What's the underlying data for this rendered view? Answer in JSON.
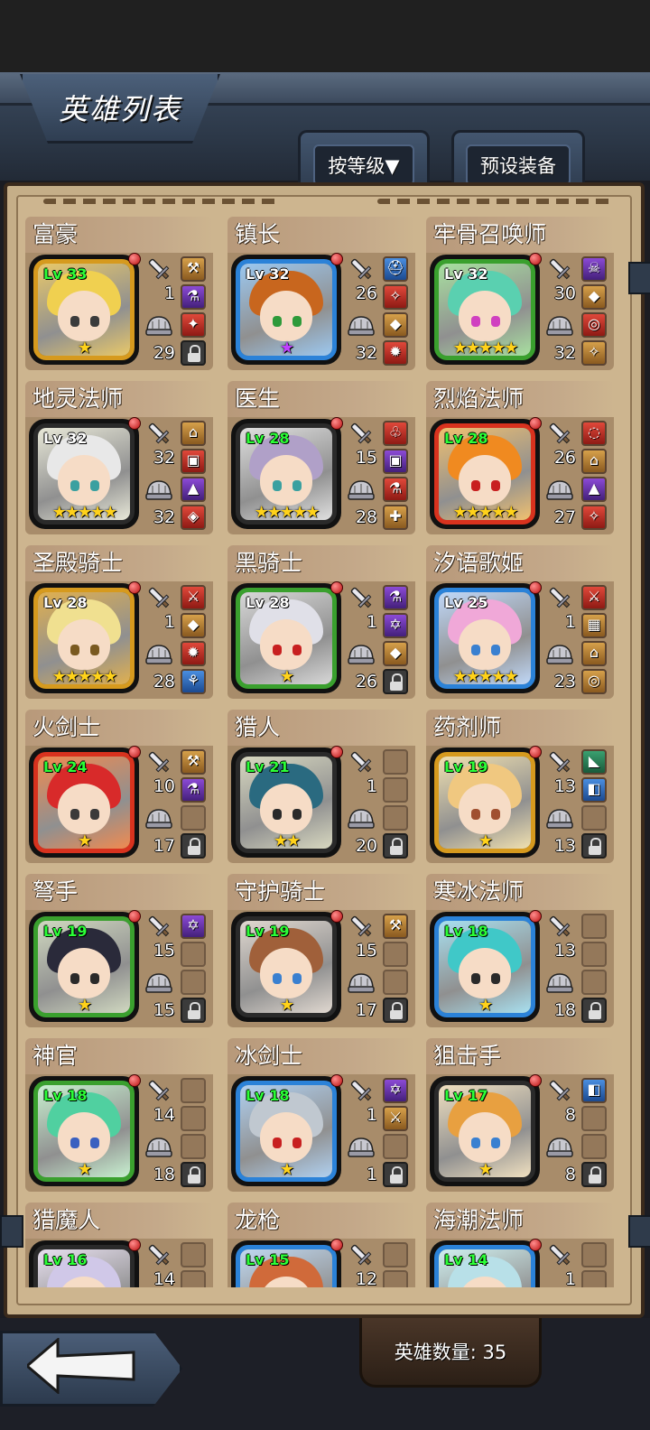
{
  "header": {
    "title": "英雄列表",
    "sort_label": "按等级▼",
    "preset_label": "预设装备"
  },
  "footer": {
    "hero_count_label": "英雄数量: 35"
  },
  "heroes": [
    {
      "name": "富豪",
      "level": "Lv 33",
      "attack": "1",
      "defense": "29",
      "stars": "★",
      "star_color": "gold",
      "frame": "#d69a1e",
      "hair": "#f0d050",
      "eyes": "#3b3b3b",
      "bg": "#e8c86a",
      "slots": [
        "orange",
        "purple",
        "red",
        "lock"
      ],
      "slot_glyphs": [
        "⚒",
        "⚗",
        "✦",
        ""
      ]
    },
    {
      "name": "镇长",
      "level": "Lv 32",
      "attack": "26",
      "defense": "32",
      "stars": "★",
      "star_color": "purple",
      "frame": "#2b82d8",
      "hair": "#c8661e",
      "eyes": "#2e9a3a",
      "bg": "#9cc8f0",
      "slots": [
        "blue",
        "red",
        "orange",
        "red"
      ],
      "slot_glyphs": [
        "⛑",
        "✧",
        "◆",
        "✹"
      ]
    },
    {
      "name": "牢骨召唤师",
      "level": "Lv 32",
      "attack": "30",
      "defense": "32",
      "stars": "★★★★★",
      "star_color": "gold",
      "frame": "#3aa02e",
      "hair": "#5ad0b0",
      "eyes": "#d040c0",
      "bg": "#a8e0a0",
      "slots": [
        "purple",
        "orange",
        "red",
        "orange"
      ],
      "slot_glyphs": [
        "☠",
        "◆",
        "◎",
        "✧"
      ]
    },
    {
      "name": "地灵法师",
      "level": "Lv 32",
      "attack": "32",
      "defense": "32",
      "stars": "★★★★★",
      "star_color": "gold",
      "frame": "#2a2a2a",
      "hair": "#e8e8e8",
      "eyes": "#3aa0a0",
      "bg": "#e8e8d8",
      "slots": [
        "orange",
        "red",
        "purple",
        "red"
      ],
      "slot_glyphs": [
        "⌂",
        "▣",
        "▲",
        "◈"
      ]
    },
    {
      "name": "医生",
      "level": "Lv 28",
      "attack": "15",
      "defense": "28",
      "stars": "★★★★★",
      "star_color": "gold",
      "frame": "#2a2a2a",
      "hair": "#b0a0c8",
      "eyes": "#3aa0a0",
      "bg": "#e0e0e0",
      "slots": [
        "red",
        "purple",
        "red",
        "orange"
      ],
      "slot_glyphs": [
        "♧",
        "▣",
        "⚗",
        "✚"
      ]
    },
    {
      "name": "烈焰法师",
      "level": "Lv 28",
      "attack": "26",
      "defense": "27",
      "stars": "★★★★★",
      "star_color": "gold",
      "frame": "#d8321e",
      "hair": "#f08a20",
      "eyes": "#c82020",
      "bg": "#f0c070",
      "slots": [
        "red",
        "orange",
        "purple",
        "red"
      ],
      "slot_glyphs": [
        "◌",
        "⌂",
        "▲",
        "✧"
      ]
    },
    {
      "name": "圣殿骑士",
      "level": "Lv 28",
      "attack": "1",
      "defense": "28",
      "stars": "★★★★★",
      "star_color": "gold",
      "frame": "#d69a1e",
      "hair": "#f0e090",
      "eyes": "#7a5a20",
      "bg": "#e0b050",
      "slots": [
        "red",
        "orange",
        "red",
        "blue"
      ],
      "slot_glyphs": [
        "⚔",
        "◆",
        "✹",
        "⚘"
      ]
    },
    {
      "name": "黑骑士",
      "level": "Lv 28",
      "attack": "1",
      "defense": "26",
      "stars": "★",
      "star_color": "gold",
      "frame": "#3aa02e",
      "hair": "#e0e0e8",
      "eyes": "#c82020",
      "bg": "#d8d8d8",
      "slots": [
        "purple",
        "purple",
        "orange",
        "lock"
      ],
      "slot_glyphs": [
        "⚗",
        "✡",
        "◆",
        ""
      ]
    },
    {
      "name": "汐语歌姬",
      "level": "Lv 25",
      "attack": "1",
      "defense": "23",
      "stars": "★★★★★",
      "star_color": "gold",
      "frame": "#2b82d8",
      "hair": "#f0a8d8",
      "eyes": "#3a80d0",
      "bg": "#c0d8f8",
      "slots": [
        "red",
        "orange",
        "orange",
        "orange"
      ],
      "slot_glyphs": [
        "⚔",
        "▦",
        "⌂",
        "◎"
      ]
    },
    {
      "name": "火剑士",
      "level": "Lv 24",
      "attack": "10",
      "defense": "17",
      "stars": "★",
      "star_color": "gold",
      "frame": "#d8321e",
      "hair": "#d82a2a",
      "eyes": "#3a3a3a",
      "bg": "#f08a50",
      "slots": [
        "orange",
        "purple",
        "empty",
        "lock"
      ],
      "slot_glyphs": [
        "⚒",
        "⚗",
        "",
        ""
      ]
    },
    {
      "name": "猎人",
      "level": "Lv 21",
      "attack": "1",
      "defense": "20",
      "stars": "★★",
      "star_color": "gold",
      "frame": "#2a2a2a",
      "hair": "#2a6a80",
      "eyes": "#2a2a2a",
      "bg": "#d8d8c0",
      "slots": [
        "empty",
        "empty",
        "empty",
        "lock"
      ],
      "slot_glyphs": [
        "",
        "",
        "",
        ""
      ]
    },
    {
      "name": "药剂师",
      "level": "Lv 19",
      "attack": "13",
      "defense": "13",
      "stars": "★",
      "star_color": "gold",
      "frame": "#d69a1e",
      "hair": "#f0c880",
      "eyes": "#a05030",
      "bg": "#f0e0b0",
      "slots": [
        "green",
        "blue",
        "empty",
        "lock"
      ],
      "slot_glyphs": [
        "◣",
        "◧",
        "",
        ""
      ]
    },
    {
      "name": "弩手",
      "level": "Lv 19",
      "attack": "15",
      "defense": "15",
      "stars": "★",
      "star_color": "gold",
      "frame": "#3aa02e",
      "hair": "#2a2a3a",
      "eyes": "#2a2a2a",
      "bg": "#d0d8c0",
      "slots": [
        "purple",
        "empty",
        "empty",
        "lock"
      ],
      "slot_glyphs": [
        "✡",
        "",
        "",
        ""
      ]
    },
    {
      "name": "守护骑士",
      "level": "Lv 19",
      "attack": "15",
      "defense": "17",
      "stars": "★",
      "star_color": "gold",
      "frame": "#2a2a2a",
      "hair": "#a0603a",
      "eyes": "#3a80d0",
      "bg": "#e0d8d0",
      "slots": [
        "orange",
        "empty",
        "empty",
        "lock"
      ],
      "slot_glyphs": [
        "⚒",
        "",
        "",
        ""
      ]
    },
    {
      "name": "寒冰法师",
      "level": "Lv 18",
      "attack": "13",
      "defense": "18",
      "stars": "★",
      "star_color": "gold",
      "frame": "#2b82d8",
      "hair": "#40c8c8",
      "eyes": "#2a2a2a",
      "bg": "#a8e0f0",
      "slots": [
        "empty",
        "empty",
        "empty",
        "lock"
      ],
      "slot_glyphs": [
        "",
        "",
        "",
        ""
      ]
    },
    {
      "name": "神官",
      "level": "Lv 18",
      "attack": "14",
      "defense": "18",
      "stars": "★",
      "star_color": "gold",
      "frame": "#3aa02e",
      "hair": "#50d0a0",
      "eyes": "#3a60c0",
      "bg": "#c8f0d0",
      "slots": [
        "empty",
        "empty",
        "empty",
        "lock"
      ],
      "slot_glyphs": [
        "",
        "",
        "",
        ""
      ]
    },
    {
      "name": "冰剑士",
      "level": "Lv 18",
      "attack": "1",
      "defense": "1",
      "stars": "★",
      "star_color": "gold",
      "frame": "#2b82d8",
      "hair": "#c0c8d0",
      "eyes": "#c82020",
      "bg": "#b0d0f0",
      "slots": [
        "purple",
        "orange",
        "empty",
        "lock"
      ],
      "slot_glyphs": [
        "✡",
        "⚔",
        "",
        ""
      ]
    },
    {
      "name": "狙击手",
      "level": "Lv 17",
      "attack": "8",
      "defense": "8",
      "stars": "★",
      "star_color": "gold",
      "frame": "#2a2a2a",
      "hair": "#e8a040",
      "eyes": "#3a80d0",
      "bg": "#f0e0c0",
      "slots": [
        "blue",
        "empty",
        "empty",
        "lock"
      ],
      "slot_glyphs": [
        "◧",
        "",
        "",
        ""
      ]
    },
    {
      "name": "猎魔人",
      "level": "Lv 16",
      "attack": "14",
      "defense": "",
      "stars": "",
      "star_color": "gold",
      "frame": "#2a2a2a",
      "hair": "#d0c8e8",
      "eyes": "#6040a0",
      "bg": "#e8e0f0",
      "slots": [
        "empty",
        "empty",
        "empty",
        "lock"
      ],
      "slot_glyphs": [
        "",
        "",
        "",
        ""
      ]
    },
    {
      "name": "龙枪",
      "level": "Lv 15",
      "attack": "12",
      "defense": "",
      "stars": "",
      "star_color": "gold",
      "frame": "#2b82d8",
      "hair": "#d06a3a",
      "eyes": "#2a2a2a",
      "bg": "#c0d8f0",
      "slots": [
        "empty",
        "empty",
        "empty",
        "lock"
      ],
      "slot_glyphs": [
        "",
        "",
        "",
        ""
      ]
    },
    {
      "name": "海潮法师",
      "level": "Lv 14",
      "attack": "1",
      "defense": "",
      "stars": "",
      "star_color": "gold",
      "frame": "#2b82d8",
      "hair": "#b8e0e8",
      "eyes": "#2a2a2a",
      "bg": "#d0f0f0",
      "slots": [
        "empty",
        "empty",
        "empty",
        "lock"
      ],
      "slot_glyphs": [
        "",
        "",
        "",
        ""
      ]
    }
  ]
}
